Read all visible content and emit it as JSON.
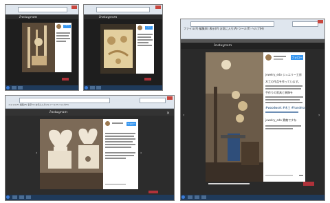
{
  "screenshots": [
    {
      "id": "s1",
      "browser": {
        "menu": ""
      },
      "instagram": {
        "logo_text": "Instagram",
        "follow_label": "フォロー"
      }
    },
    {
      "id": "s2",
      "browser": {
        "menu": ""
      },
      "instagram": {
        "logo_text": "Instagram",
        "follow_label": "フォロー"
      }
    },
    {
      "id": "s3",
      "browser": {
        "menu": "ファイル(F)  編集(E)  表示(V)  お気に入り(A)  ツール(T)  ヘルプ(H)"
      },
      "instagram": {
        "logo_text": "Instagram",
        "follow_label": "フォロー"
      },
      "caption_lines": [
        "jewelry_edo ジュエリー工房",
        "木工の作品を作っています。",
        "手作りの家具と装飾を",
        "#woodwork #木工 #handmade",
        "jewelry_edo 素敵ですね"
      ]
    },
    {
      "id": "s4",
      "browser": {
        "menu": "ファイル(F)  編集(E)  表示(V)  お気に入り(A)  ツール(T)  ヘルプ(H)"
      },
      "instagram": {
        "logo_text": "Instagram",
        "follow_label": "フォロー"
      }
    }
  ],
  "colors": {
    "accent": "#3897f0",
    "chrome": "#dfe6ee",
    "dark": "#3a3a3a",
    "taskbar": "#1f3a5a"
  }
}
